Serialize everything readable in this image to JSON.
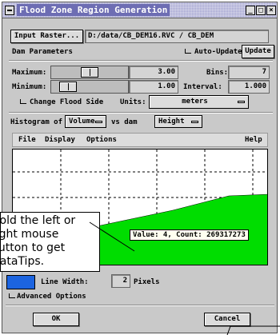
{
  "window": {
    "title": "Flood Zone Region Generation",
    "minimize_glyph": "_",
    "maximize_glyph": "□",
    "close_glyph": "×"
  },
  "input": {
    "button_label": "Input Raster...",
    "path": "D:/data/CB_DEM16.RVC / CB_DEM"
  },
  "dam_parameters": {
    "heading": "Dam Parameters",
    "auto_update_label": "Auto-Update",
    "update_button": "Update",
    "maximum_label": "Maximum:",
    "maximum_value": "3.00",
    "maximum_slider_level": 0.5,
    "minimum_label": "Minimum:",
    "minimum_value": "1.00",
    "minimum_slider_level": 0.12,
    "bins_label": "Bins:",
    "bins_value": "7",
    "interval_label": "Interval:",
    "interval_value": "1.000",
    "change_side_label": "Change Flood Side",
    "units_label": "Units:",
    "units_value": "meters"
  },
  "histogram": {
    "label_of": "Histogram of",
    "of_value": "Volume",
    "label_vs": "vs dam",
    "vs_value": "Height",
    "menu": {
      "file": "File",
      "display": "Display",
      "options": "Options",
      "help": "Help"
    },
    "fill_color": "#00dd00",
    "tooltip": "Value: 4, Count: 269317273"
  },
  "callout": {
    "lines": [
      "Hold the left or",
      "right mouse",
      "button to get",
      "DataTips."
    ]
  },
  "line_settings": {
    "swatch_color": "#1c64e0",
    "line_width_label": "Line Width:",
    "line_width_value": "2",
    "units": "Pixels"
  },
  "advanced_label": "Advanced Options",
  "buttons": {
    "ok": "OK",
    "cancel": "Cancel"
  }
}
